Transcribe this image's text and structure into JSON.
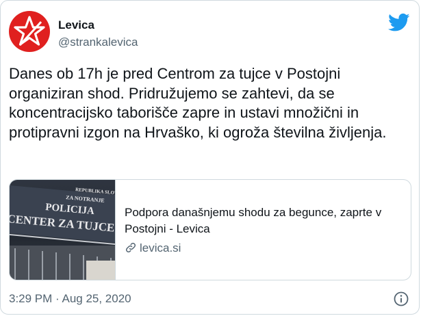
{
  "user": {
    "display_name": "Levica",
    "handle": "@strankalevica",
    "avatar_icon": "red-star-icon",
    "avatar_color": "#e0201f"
  },
  "brand": {
    "logo_icon": "twitter-bird-icon",
    "color": "#1d9bf0"
  },
  "tweet": {
    "text": "Danes ob 17h je pred Centrom za tujce v Postojni organiziran shod. Pridružujemo se zahtevi, da se koncentracijsko taborišče zapre in ustavi množični in protipravni izgon na Hrvaško, ki ogroža številna življenja.",
    "timestamp": "3:29 PM · Aug 25, 2020"
  },
  "link_card": {
    "image_sign_lines": [
      "REPUBLIKA SLOVENIJA",
      "ZA NOTRANJE",
      "POLICIJA",
      "CENTER ZA TUJCE"
    ],
    "title": "Podpora današnjemu shodu za begunce, zaprte v Postojni - Levica",
    "domain": "levica.si",
    "domain_icon": "link-icon"
  },
  "footer": {
    "info_icon": "info-icon"
  }
}
